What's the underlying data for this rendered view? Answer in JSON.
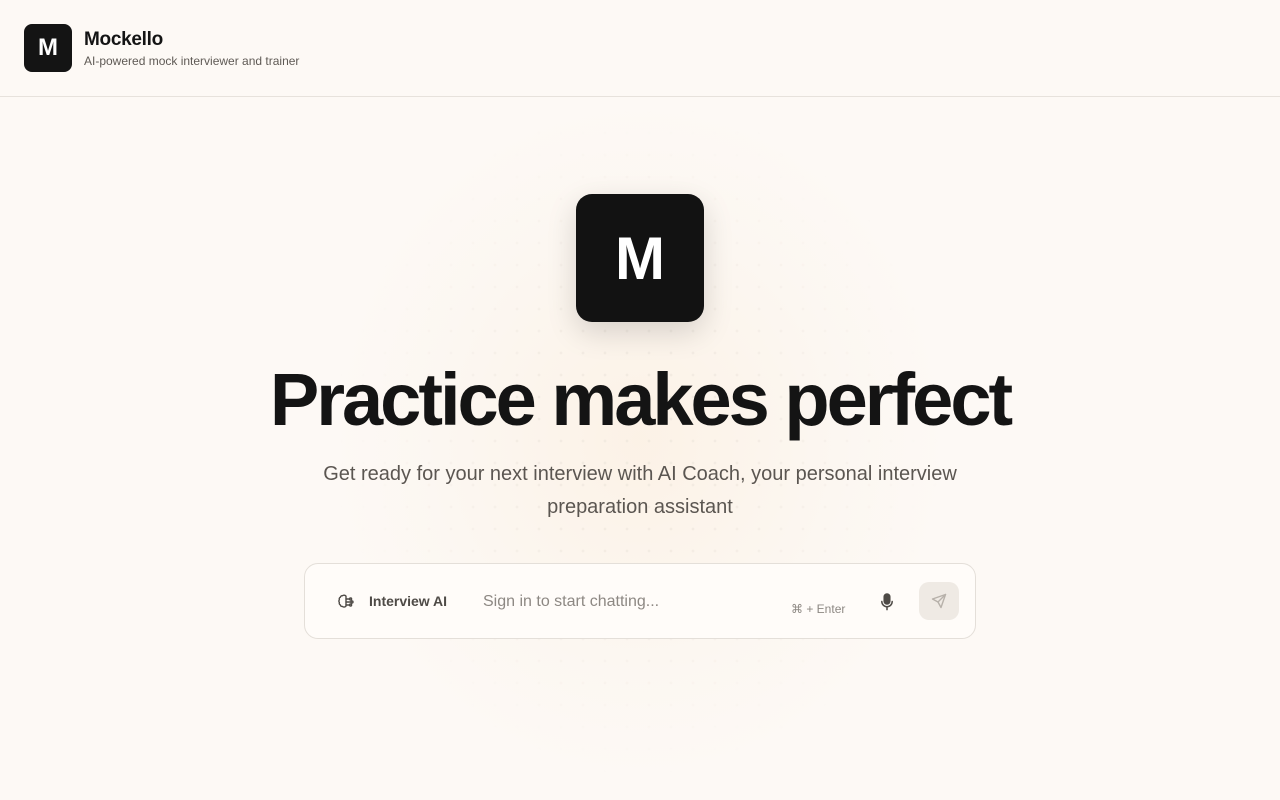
{
  "header": {
    "logo_letter": "M",
    "app_name": "Mockello",
    "tagline": "AI-powered mock interviewer and trainer"
  },
  "hero": {
    "logo_letter": "M",
    "title": "Practice makes perfect",
    "subtitle": "Get ready for your next interview with AI Coach, your personal interview preparation assistant"
  },
  "chat": {
    "mode_icon": "brain-icon",
    "mode_label": "Interview AI",
    "placeholder": "Sign in to start chatting...",
    "shortcut": "⌘ + Enter",
    "mic_icon": "microphone-icon",
    "send_icon": "send-icon"
  }
}
